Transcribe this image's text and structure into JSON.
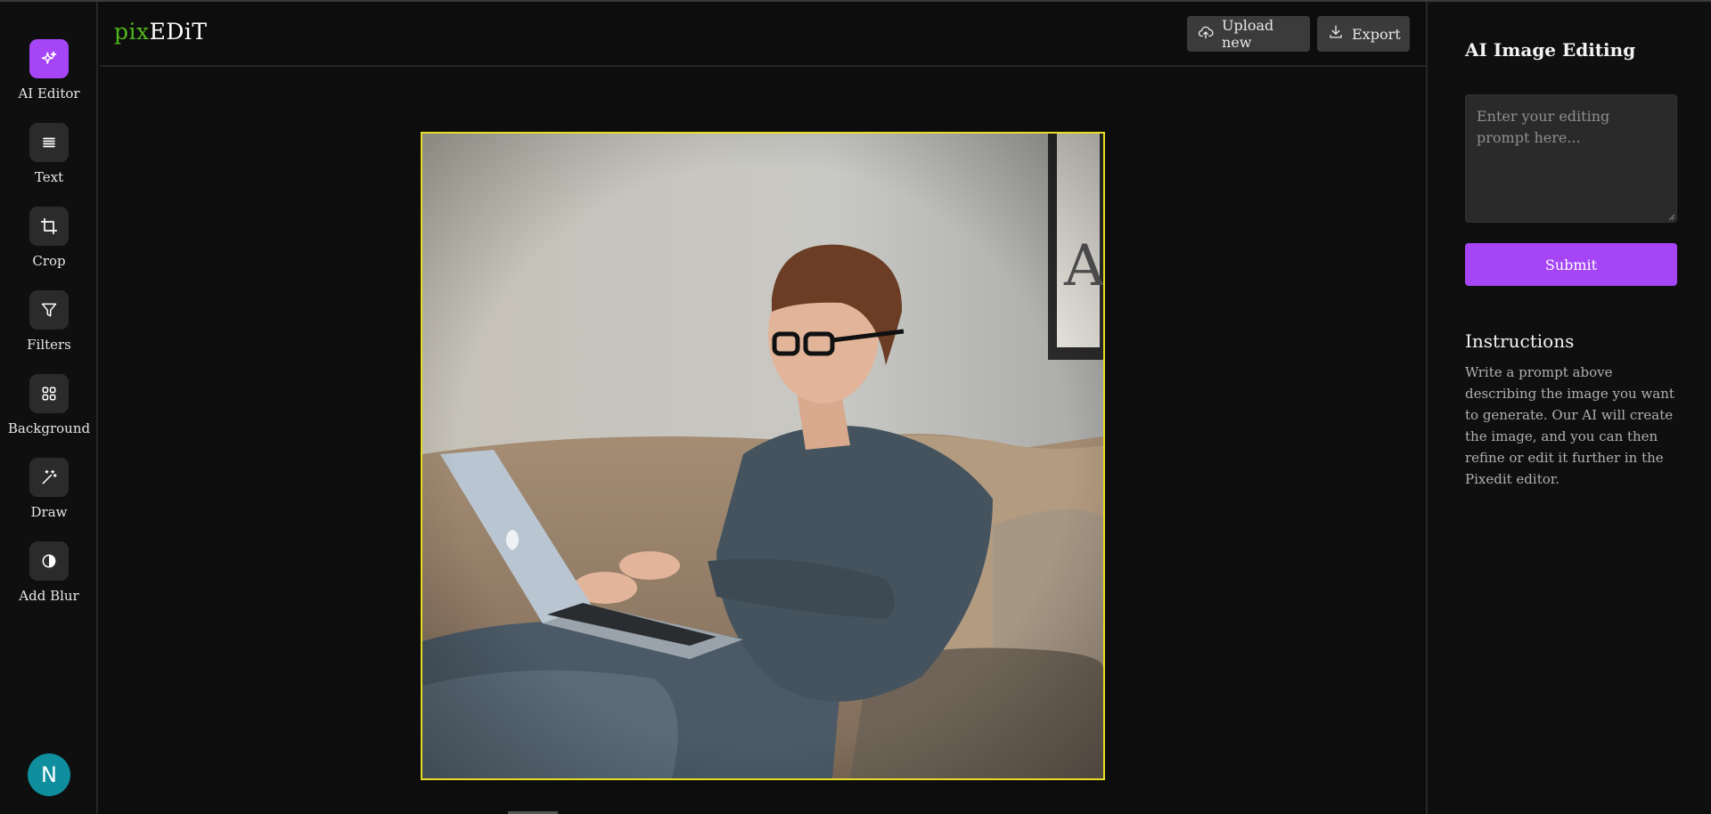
{
  "app": {
    "logo_part1": "pix",
    "logo_part2": "EDiT",
    "accent_color": "#a545f5",
    "logo_green": "#4fb81c",
    "frame_color": "#e8dc24"
  },
  "sidebar": {
    "items": [
      {
        "label": "AI Editor",
        "icon": "sparkles-icon",
        "active": true
      },
      {
        "label": "Text",
        "icon": "text-lines-icon",
        "active": false
      },
      {
        "label": "Crop",
        "icon": "crop-icon",
        "active": false
      },
      {
        "label": "Filters",
        "icon": "filter-funnel-icon",
        "active": false
      },
      {
        "label": "Background",
        "icon": "grid-icon",
        "active": false
      },
      {
        "label": "Draw",
        "icon": "magic-wand-icon",
        "active": false
      },
      {
        "label": "Add Blur",
        "icon": "half-circle-icon",
        "active": false
      }
    ],
    "avatar_initial": "N"
  },
  "header": {
    "upload_label": "Upload new",
    "export_label": "Export"
  },
  "panel": {
    "title": "AI Image Editing",
    "prompt_placeholder": "Enter your editing prompt here...",
    "prompt_value": "",
    "submit_label": "Submit",
    "instructions_title": "Instructions",
    "instructions_text": "Write a prompt above describing the image you want to generate. Our AI will create the image, and you can then refine or edit it further in the Pixedit editor."
  }
}
